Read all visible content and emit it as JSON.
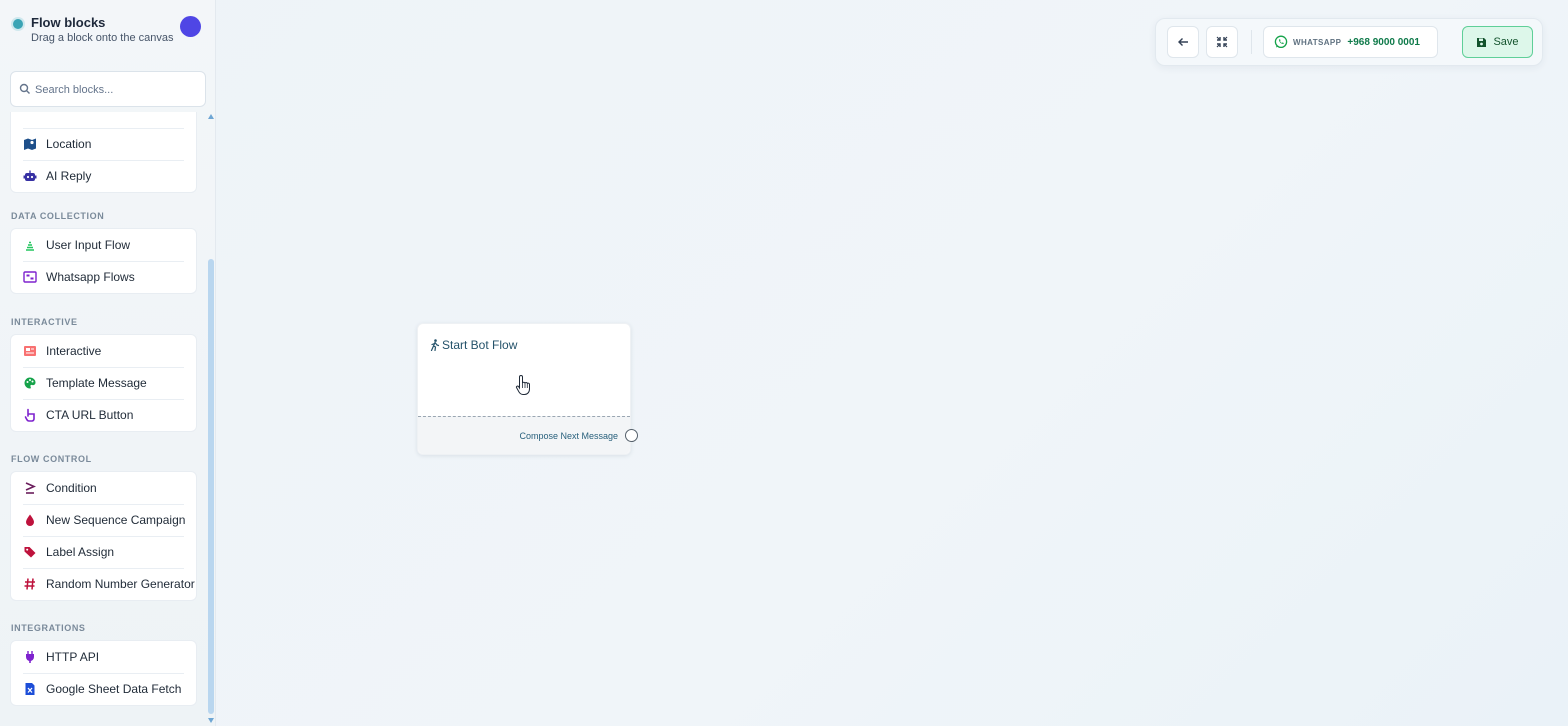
{
  "sidebar": {
    "title": "Flow blocks",
    "subtitle": "Drag a block onto the canvas",
    "search_placeholder": "Search blocks...",
    "groups": [
      {
        "title": "",
        "items": [
          {
            "label": "Location",
            "icon": "map-icon",
            "color": "#1e4f8a"
          },
          {
            "label": "AI Reply",
            "icon": "robot-icon",
            "color": "#3730a3"
          }
        ]
      },
      {
        "title": "DATA COLLECTION",
        "items": [
          {
            "label": "User Input Flow",
            "icon": "stack-icon",
            "color": "#22c55e"
          },
          {
            "label": "Whatsapp Flows",
            "icon": "flow-icon",
            "color": "#7e22ce"
          }
        ]
      },
      {
        "title": "INTERACTIVE",
        "items": [
          {
            "label": "Interactive",
            "icon": "newspaper-icon",
            "color": "#f87171"
          },
          {
            "label": "Template Message",
            "icon": "palette-icon",
            "color": "#16a34a"
          },
          {
            "label": "CTA URL Button",
            "icon": "pointer-hand-icon",
            "color": "#7e22ce"
          }
        ]
      },
      {
        "title": "FLOW CONTROL",
        "items": [
          {
            "label": "Condition",
            "icon": "greater-equal-icon",
            "color": "#6b1d5c"
          },
          {
            "label": "New Sequence Campaign",
            "icon": "drop-icon",
            "color": "#be123c"
          },
          {
            "label": "Label Assign",
            "icon": "tags-icon",
            "color": "#be123c"
          },
          {
            "label": "Random Number Generator",
            "icon": "hashtag-icon",
            "color": "#be123c"
          }
        ]
      },
      {
        "title": "INTEGRATIONS",
        "items": [
          {
            "label": "HTTP API",
            "icon": "plug-icon",
            "color": "#7e22ce"
          },
          {
            "label": "Google Sheet Data Fetch",
            "icon": "spreadsheet-icon",
            "color": "#1d4ed8"
          }
        ]
      }
    ]
  },
  "toolbar": {
    "channel_label": "WHATSAPP",
    "phone": "+968 9000 0001",
    "save_label": "Save"
  },
  "canvas": {
    "node": {
      "title": "Start Bot Flow",
      "footer_label": "Compose Next Message"
    }
  }
}
